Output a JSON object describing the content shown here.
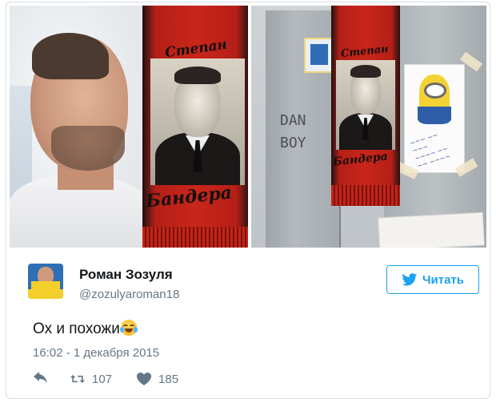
{
  "photos": {
    "left": {
      "scarf_text_top": "Степан",
      "scarf_text_bottom": "Бандера"
    },
    "right": {
      "scarf_text_top": "Степан",
      "scarf_text_bottom": "Бандера",
      "locker_doodle": "DAN\nBOY"
    }
  },
  "author": {
    "display_name": "Роман Зозуля",
    "handle": "@zozulyaroman18"
  },
  "follow_button": {
    "label": "Читать"
  },
  "tweet": {
    "text": "Ох и похожи",
    "emoji": "face-with-tears-of-joy",
    "timestamp": "16:02 - 1 декабря 2015"
  },
  "actions": {
    "reply_icon": "reply-icon",
    "retweet_count": "107",
    "like_count": "185"
  },
  "colors": {
    "accent": "#1da1f2",
    "text": "#14171a",
    "secondary_text": "#657786",
    "scarf_red": "#c9261a"
  }
}
